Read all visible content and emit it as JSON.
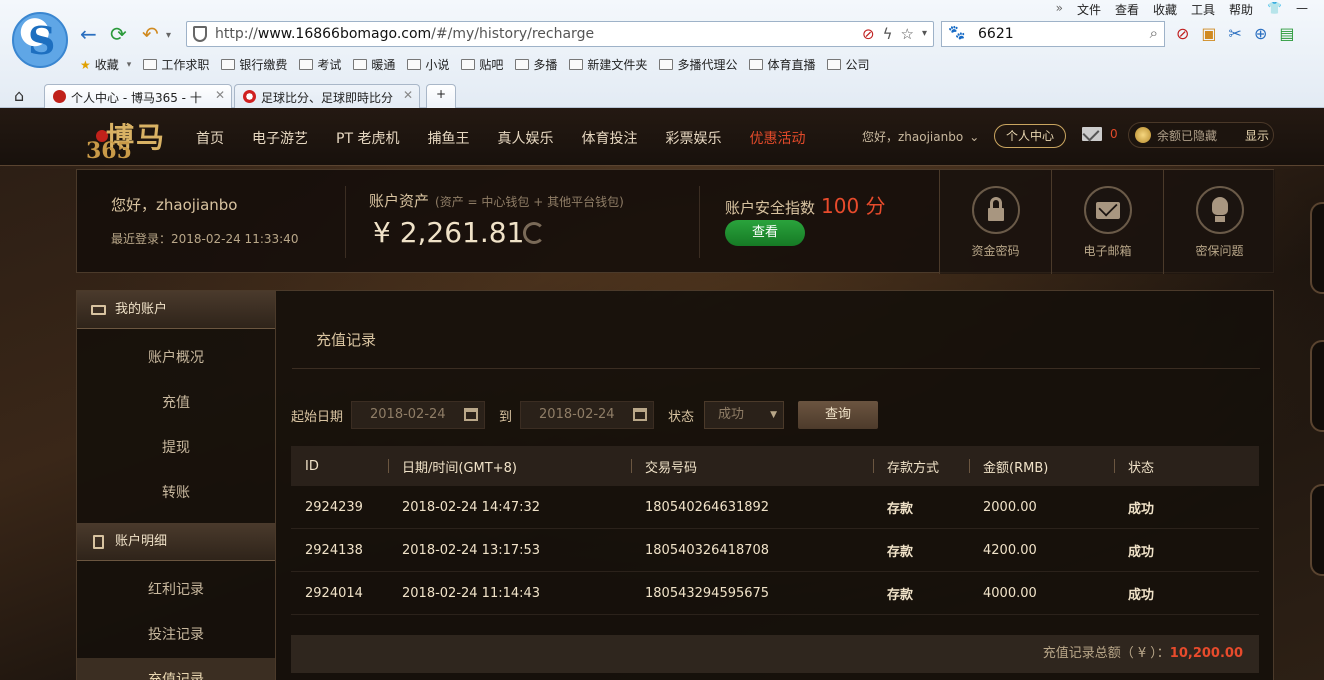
{
  "browser": {
    "menu": [
      "文件",
      "查看",
      "收藏",
      "工具",
      "帮助"
    ],
    "url_prefix": "http://",
    "url_host": "www.16866bomago.com",
    "url_path": "/#/my/history/recharge",
    "search_value": "6621",
    "bookmarks": [
      "收藏",
      "工作求职",
      "银行缴费",
      "考试",
      "暖通",
      "小说",
      "贴吧",
      "多播",
      "新建文件夹",
      "多播代理公",
      "体育直播",
      "公司"
    ],
    "tabs": [
      {
        "label": "个人中心 - 博马365 - 十"
      },
      {
        "label": "足球比分、足球即時比分"
      }
    ]
  },
  "site": {
    "logo_top": "博马",
    "logo_bottom": "365",
    "nav": [
      "首页",
      "电子游艺",
      "PT 老虎机",
      "捕鱼王",
      "真人娱乐",
      "体育投注",
      "彩票娱乐",
      "优惠活动"
    ],
    "greeting": "您好，zhaojianbo",
    "center_button": "个人中心",
    "mail_count": "0",
    "balance_hidden": "余额已隐藏",
    "show_label": "显示"
  },
  "account": {
    "hello": "您好，zhaojianbo",
    "last_login": "最近登录：2018-02-24 11:33:40",
    "assets_title": "账户资产",
    "assets_note": "(资产 = 中心钱包 + 其他平台钱包)",
    "assets_value": "¥ 2,261.81",
    "security_title": "账户安全指数",
    "security_score": "100 分",
    "check_button": "查看",
    "security_items": [
      "资金密码",
      "电子邮箱",
      "密保问题"
    ]
  },
  "sidebar": {
    "sections": [
      {
        "title": "我的账户",
        "items": [
          "账户概况",
          "充值",
          "提现",
          "转账"
        ]
      },
      {
        "title": "账户明细",
        "items": [
          "红利记录",
          "投注记录",
          "充值记录"
        ]
      }
    ]
  },
  "main": {
    "title": "充值记录",
    "filter": {
      "start_label": "起始日期",
      "start_date": "2018-02-24",
      "to_label": "到",
      "end_date": "2018-02-24",
      "status_label": "状态",
      "status_value": "成功",
      "query_button": "查询"
    },
    "columns": [
      "ID",
      "日期/时间(GMT+8)",
      "交易号码",
      "存款方式",
      "金额(RMB)",
      "状态"
    ],
    "rows": [
      {
        "id": "2924239",
        "datetime": "2018-02-24 14:47:32",
        "tx": "180540264631892",
        "method": "存款",
        "amount": "2000.00",
        "status": "成功"
      },
      {
        "id": "2924138",
        "datetime": "2018-02-24 13:17:53",
        "tx": "180540326418708",
        "method": "存款",
        "amount": "4200.00",
        "status": "成功"
      },
      {
        "id": "2924014",
        "datetime": "2018-02-24 11:14:43",
        "tx": "180543294595675",
        "method": "存款",
        "amount": "4000.00",
        "status": "成功"
      }
    ],
    "total_label": "充值记录总额（ ¥ ）：",
    "total_value": "10,200.00"
  },
  "colors": {
    "accent_red": "#e84b2c",
    "gold": "#c9a560",
    "green": "#2aa33c"
  }
}
